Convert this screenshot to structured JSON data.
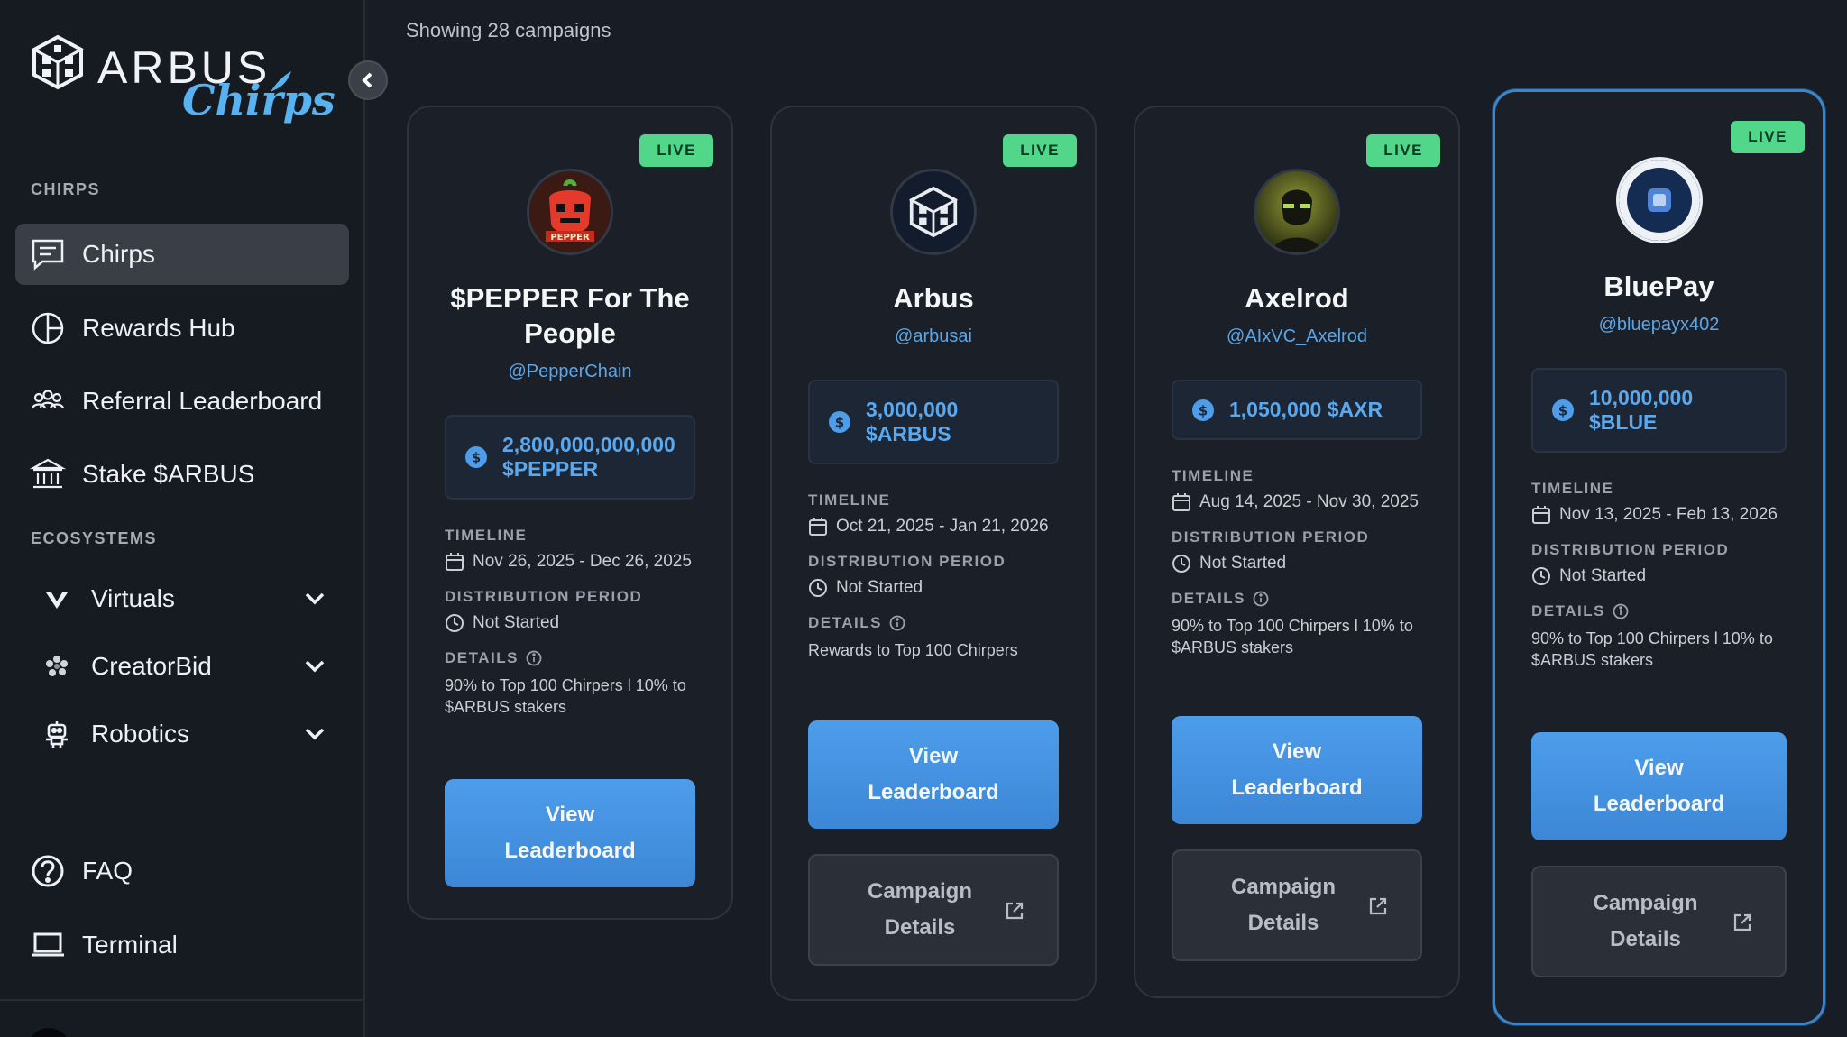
{
  "sidebar": {
    "logo_word": "ARBUS",
    "logo_sub": "Chirps",
    "section_chirps": "CHIRPS",
    "section_ecosystems": "ECOSYSTEMS",
    "items": [
      {
        "label": "Chirps",
        "icon": "chat-icon",
        "active": true
      },
      {
        "label": "Rewards Hub",
        "icon": "pie-chart-icon"
      },
      {
        "label": "Referral Leaderboard",
        "icon": "group-icon"
      },
      {
        "label": "Stake $ARBUS",
        "icon": "bank-icon"
      }
    ],
    "ecosystems": [
      {
        "label": "Virtuals",
        "icon": "virtuals-icon"
      },
      {
        "label": "CreatorBid",
        "icon": "creatorbid-icon"
      },
      {
        "label": "Robotics",
        "icon": "robot-icon"
      }
    ],
    "footer": [
      {
        "label": "FAQ",
        "icon": "question-icon"
      },
      {
        "label": "Terminal",
        "icon": "laptop-icon"
      }
    ]
  },
  "main": {
    "showing": "Showing 28 campaigns",
    "labels": {
      "live": "LIVE",
      "timeline": "TIMELINE",
      "distribution": "DISTRIBUTION PERIOD",
      "details": "DETAILS",
      "view": "View",
      "leaderboard": "Leaderboard",
      "campaign": "Campaign",
      "campaign_details": "Details"
    },
    "campaigns": [
      {
        "title": "$PEPPER For The People",
        "handle": "@PepperChain",
        "reward_amount": "2,800,000,000,000",
        "reward_token": "$PEPPER",
        "timeline": "Nov 26, 2025 - Dec 26, 2025",
        "distribution": "Not Started",
        "details": "90% to Top 100 Chirpers l 10% to $ARBUS stakers",
        "avatar_text": "PEPPER"
      },
      {
        "title": "Arbus",
        "handle": "@arbusai",
        "reward_amount": "3,000,000",
        "reward_token": "$ARBUS",
        "timeline": "Oct 21, 2025 - Jan 21, 2026",
        "distribution": "Not Started",
        "details": "Rewards to Top 100 Chirpers"
      },
      {
        "title": "Axelrod",
        "handle": "@AIxVC_Axelrod",
        "reward_amount": "1,050,000 $AXR",
        "timeline": "Aug 14, 2025 - Nov 30, 2025",
        "distribution": "Not Started",
        "details": "90% to Top 100 Chirpers l 10% to $ARBUS stakers"
      },
      {
        "title": "BluePay",
        "handle": "@bluepayx402",
        "reward_amount": "10,000,000",
        "reward_token": "$BLUE",
        "timeline": "Nov 13, 2025 - Feb 13, 2026",
        "distribution": "Not Started",
        "details": "90% to Top 100 Chirpers l 10% to $ARBUS stakers"
      }
    ]
  },
  "colors": {
    "accent": "#4d9deb",
    "live": "#52d68a",
    "background": "#181c24"
  }
}
